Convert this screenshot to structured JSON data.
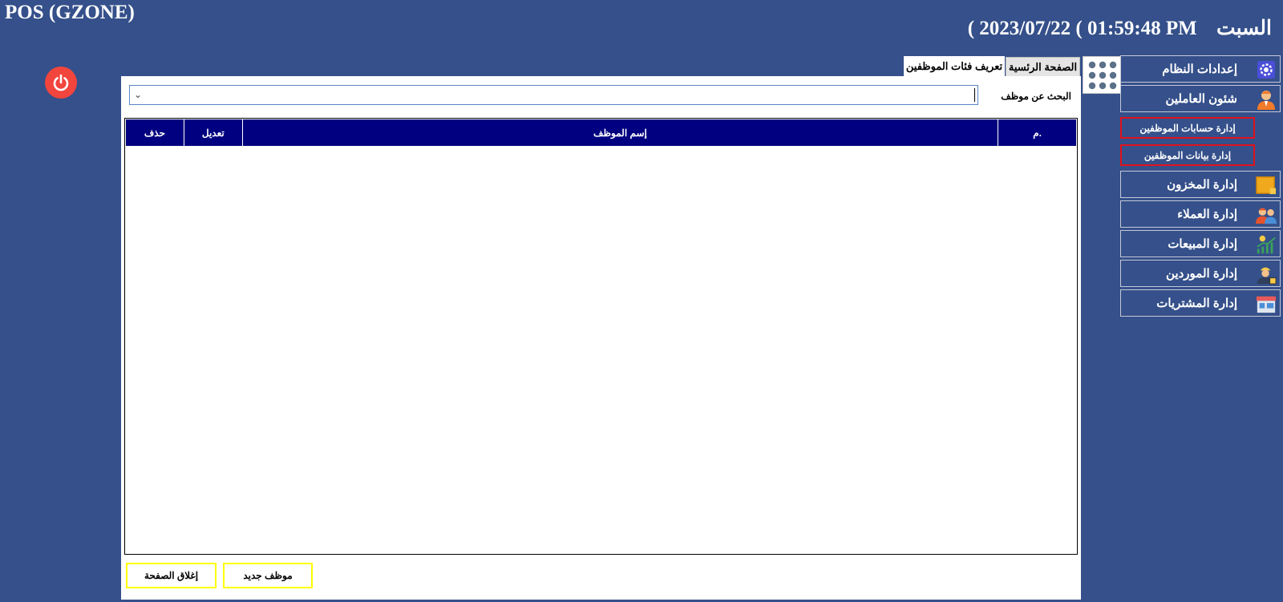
{
  "app": {
    "title": "POS (GZONE)"
  },
  "header": {
    "datetime": "( 2023/07/22 ( 01:59:48 PM",
    "day": "السبت"
  },
  "tabs": [
    {
      "label": "تعريف فئات الموظفين",
      "active": true
    },
    {
      "label": "الصفحة الرئسية",
      "active": false
    }
  ],
  "search": {
    "label": "البحث عن موظف",
    "value": ""
  },
  "table": {
    "columns": [
      "م.",
      "إسم الموظف",
      "تعديل",
      "حذف"
    ],
    "header_color": "#000080",
    "rows": []
  },
  "buttons": {
    "new_employee": "موظف جديد",
    "close_page": "إغلاق الصفحة"
  },
  "sidebar": {
    "items": [
      {
        "label": "إعدادات النظام",
        "icon": "gear-icon"
      },
      {
        "label": "شئون العاملين",
        "icon": "user-icon"
      },
      {
        "label": "إدارة المخزون",
        "icon": "box-icon"
      },
      {
        "label": "إدارة العملاء",
        "icon": "customers-icon"
      },
      {
        "label": "إدارة المبيعات",
        "icon": "sales-chart-icon"
      },
      {
        "label": "إدارة الموردين",
        "icon": "supplier-icon"
      },
      {
        "label": "إدارة المشتريات",
        "icon": "store-icon"
      }
    ],
    "subitems": [
      {
        "label": "إدارة حسابات الموظفين"
      },
      {
        "label": "إدارة بيانات الموظفين"
      }
    ]
  },
  "colors": {
    "background": "#35508a",
    "accent_red": "#f1453d",
    "button_border": "#ffff00",
    "sub_border": "#e0121e"
  }
}
